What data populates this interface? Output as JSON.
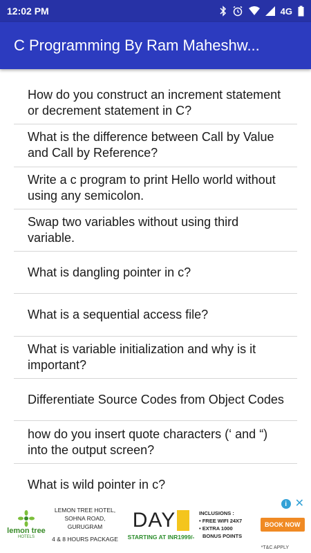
{
  "status_bar": {
    "time": "12:02 PM",
    "network": "4G",
    "icons": [
      "bluetooth-icon",
      "alarm-icon",
      "wifi-icon",
      "signal-icon",
      "battery-icon"
    ]
  },
  "app_bar": {
    "title": "C Programming By Ram Maheshw..."
  },
  "questions": [
    "How do you construct an increment statement or decrement statement in C?",
    "What is the difference between Call by Value and Call by Reference?",
    "Write a c program to print Hello world without using any semicolon.",
    "Swap two variables without using third variable.",
    "What is dangling pointer in c?",
    "What is a sequential access file?",
    "What is variable initialization and why is it important?",
    "Differentiate Source Codes from Object Codes",
    "how do you insert quote characters (‘ and “) into the output screen?",
    "What is wild pointer in c?"
  ],
  "ad": {
    "brand": "lemon tree",
    "brand_sub": "HOTELS",
    "hotel_line1": "LEMON TREE HOTEL,",
    "hotel_line2": "SOHNA ROAD, GURUGRAM",
    "hotel_line3": "4 & 8 HOURS PACKAGE",
    "day": "DAY",
    "starting": "STARTING AT INR1999/-",
    "inclusions_title": "INCLUSIONS :",
    "inclusion_1": "• FREE WIFI 24X7",
    "inclusion_2": "• EXTRA 1000",
    "inclusion_3": "BONUS POINTS",
    "book": "BOOK NOW",
    "tnc": "*T&C APPLY",
    "colors": {
      "accent": "#f08a24",
      "brand_green": "#3a8c2a",
      "info": "#33a1d6"
    }
  },
  "colors": {
    "status_bar": "#2732a6",
    "app_bar": "#2c3bbf",
    "divider": "#d6d6d6"
  }
}
